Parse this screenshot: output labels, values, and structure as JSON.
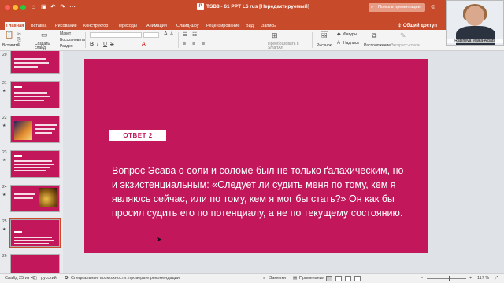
{
  "window": {
    "title": "TSB8 - 61 PPT L6 rus [Нередактируемый]",
    "search_placeholder": "Поиск в презентации"
  },
  "ribbon_tabs": [
    {
      "label": "Главная",
      "active": true
    },
    {
      "label": "Вставка"
    },
    {
      "label": "Рисование"
    },
    {
      "label": "Конструктор"
    },
    {
      "label": "Переходы"
    },
    {
      "label": "Анимация"
    },
    {
      "label": "Слайд-шоу"
    },
    {
      "label": "Рецензирование"
    },
    {
      "label": "Вид"
    },
    {
      "label": "Запись"
    }
  ],
  "share_label": "Общий доступ",
  "ribbon": {
    "paste": "Вставить",
    "new_slide": "Создать слайд",
    "layout": "Макет",
    "reset": "Восстановить",
    "section": "Раздел",
    "smartart": "Преобразовать в SmartArt",
    "picture": "Рисунок",
    "shapes": "Фигуры",
    "textbox": "Надпись",
    "arrange": "Расположение",
    "express": "Экспресс-стили"
  },
  "video": {
    "name": "Ratsheva Malka-Albats"
  },
  "thumbnails": [
    {
      "number": "20"
    },
    {
      "number": "21"
    },
    {
      "number": "22"
    },
    {
      "number": "23"
    },
    {
      "number": "24"
    },
    {
      "number": "25"
    },
    {
      "number": "26"
    }
  ],
  "slide": {
    "answer_label": "ОТВЕТ 2",
    "body": "Вопрос Эсава о соли и соломе был не только ґалахическим, но и экзистенциальным: «Следует ли судить меня по тому, кем я являюсь сейчас, или по тому, кем я мог бы стать?» Он как бы просил судить его по потенциалу, а не по текущему состоянию.",
    "background_color": "#c2185b"
  },
  "status": {
    "slide_counter": "Слайд 25 из 43",
    "language": "русский",
    "accessibility": "Специальные возможности: проверьте рекомендации",
    "notes": "Заметки",
    "comments": "Примечания",
    "zoom": "117 %"
  },
  "colors": {
    "accent": "#c74b2a",
    "slide": "#c2185b"
  }
}
